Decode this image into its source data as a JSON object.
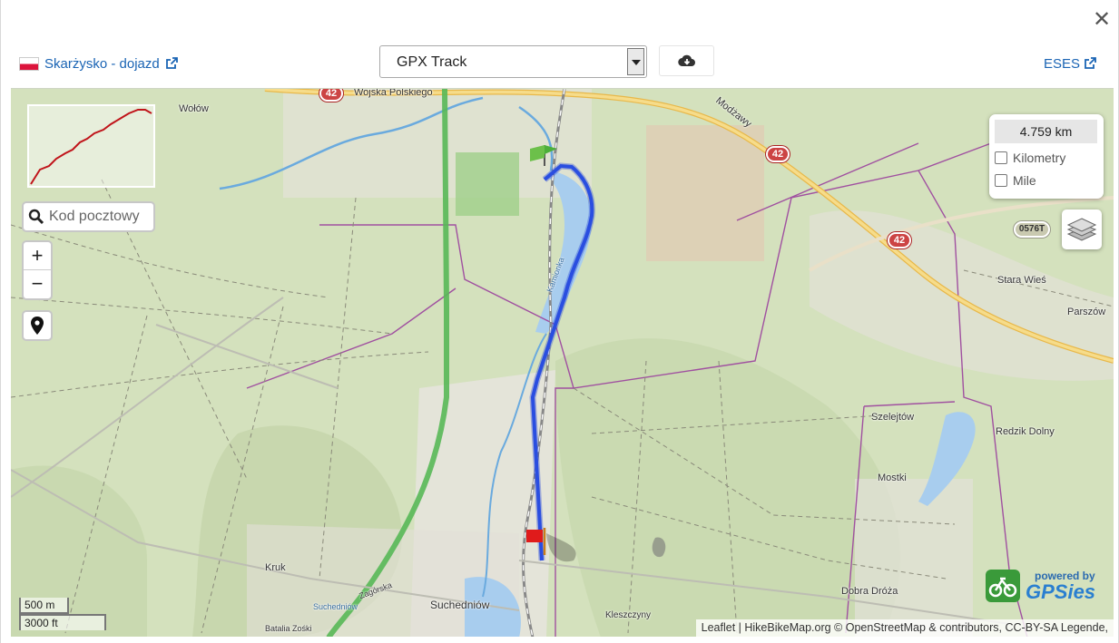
{
  "header": {
    "close_label": "✕",
    "track_name": "Skarżysko - dojazd",
    "format_selected": "GPX Track",
    "right_link": "ESES"
  },
  "search": {
    "placeholder": "Kod pocztowy"
  },
  "zoom": {
    "in_label": "+",
    "out_label": "−"
  },
  "distance_panel": {
    "total": "4.759 km",
    "unit_km_label": "Kilometry",
    "unit_mi_label": "Mile"
  },
  "scale": {
    "metric": "500 m",
    "imperial": "3000 ft"
  },
  "attribution": {
    "leaflet": "Leaflet",
    "rest": " | HikeBikeMap.org © OpenStreetMap & contributors, CC-BY-SA Legende,"
  },
  "logo": {
    "powered_by": "powered by",
    "brand": "GPSies"
  },
  "map_labels": {
    "wolow": "Wołów",
    "wojska": "Wojska Polskiego",
    "miedzyrzecka": "Modżawy",
    "karnowka": "Kamionka",
    "stara_wies": "Stara Wieś",
    "parszow": "Parszów",
    "szelejtow": "Szelejtów",
    "redzik": "Redzik Dolny",
    "mostki": "Mostki",
    "dobra": "Dobra Dróża",
    "kruk": "Kruk",
    "zagorska": "Zagórska",
    "suchedniow_water": "Suchedniów",
    "suchedniow": "Suchedniów",
    "batalia": "Batalia Zośki",
    "klonow": "Kleszczyny",
    "road_42": "42",
    "road_0576": "0576T"
  },
  "colors": {
    "track": "#2a4ee0",
    "map_green": "#cfdcb6",
    "water": "#a8cdee",
    "accent_link": "#1a64b4"
  }
}
